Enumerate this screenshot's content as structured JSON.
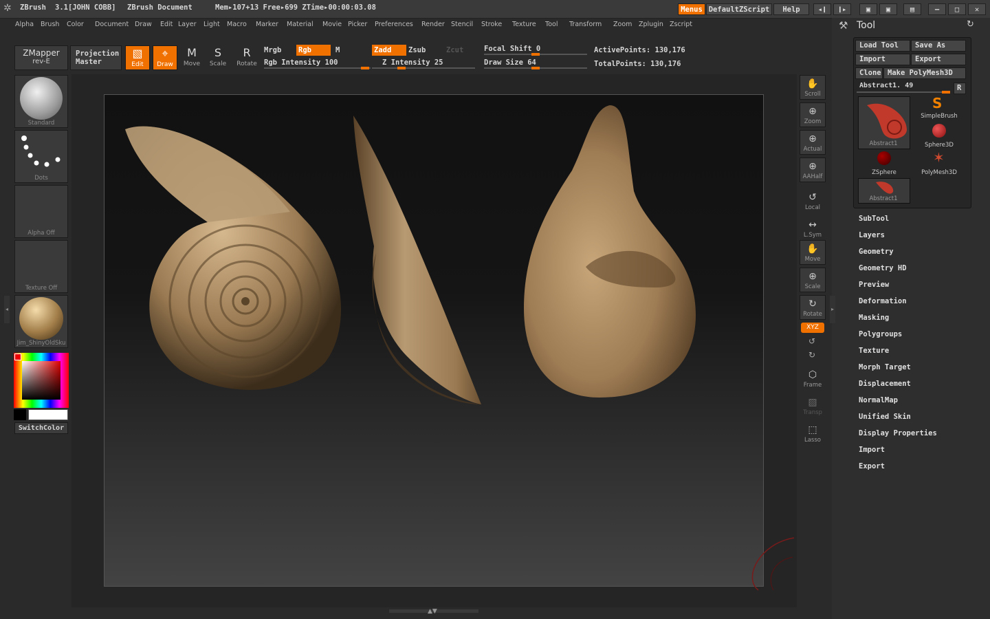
{
  "title_bar": {
    "app": "ZBrush",
    "version": "3.1[JOHN COBB]",
    "document": "ZBrush Document",
    "mem": "Mem▸107+13  Free▸699  ZTime▸00:00:03.08",
    "menus_label": "Menus",
    "script_label": "DefaultZScript",
    "help_label": "Help"
  },
  "menu_bar": [
    "Alpha",
    "Brush",
    "Color",
    "Document",
    "Draw",
    "Edit",
    "Layer",
    "Light",
    "Macro",
    "Marker",
    "Material",
    "Movie",
    "Picker",
    "Preferences",
    "Render",
    "Stencil",
    "Stroke",
    "Texture",
    "Tool",
    "Transform",
    "Zoom",
    "Zplugin",
    "Zscript"
  ],
  "toolbar": {
    "zmapper_label": "ZMapper",
    "zmapper_sub": "rev-E",
    "projection_label": "Projection",
    "projection_sub": "Master",
    "edit_label": "Edit",
    "draw_label": "Draw",
    "move_label": "Move",
    "scale_label": "Scale",
    "rotate_label": "Rotate",
    "mrgb_label": "Mrgb",
    "rgb_label": "Rgb",
    "m_label": "M",
    "rgb_intensity": "Rgb Intensity 100",
    "zadd_label": "Zadd",
    "zsub_label": "Zsub",
    "zcut_label": "Zcut",
    "z_intensity": "Z Intensity 25",
    "focal_shift": "Focal Shift 0",
    "draw_size": "Draw Size 64",
    "active_points": "ActivePoints: 130,176",
    "total_points": "TotalPoints: 130,176"
  },
  "left_shelf": {
    "brush_label": "Standard",
    "stroke_label": "Dots",
    "alpha_label": "Alpha  Off",
    "texture_label": "Texture  Off",
    "material_label": "Jim_ShinyOldSku",
    "switch_color_label": "SwitchColor"
  },
  "right_shelf": [
    "Scroll",
    "Zoom",
    "Actual",
    "AAHalf",
    "Local",
    "L.Sym",
    "Move",
    "Scale",
    "Rotate",
    "XYZ",
    "Frame",
    "Transp",
    "Lasso"
  ],
  "tool_panel": {
    "title": "Tool",
    "load_tool": "Load Tool",
    "save_as": "Save As",
    "import": "Import",
    "export": "Export",
    "clone": "Clone",
    "make_polymesh": "Make PolyMesh3D",
    "current_tool": "Abstract1. 49",
    "r_label": "R",
    "thumbnails": [
      "Abstract1",
      "SimpleBrush",
      "Sphere3D",
      "ZSphere",
      "PolyMesh3D",
      "Abstract1"
    ],
    "subpalettes": [
      "SubTool",
      "Layers",
      "Geometry",
      "Geometry HD",
      "Preview",
      "Deformation",
      "Masking",
      "Polygroups",
      "Texture",
      "Morph Target",
      "Displacement",
      "NormalMap",
      "Unified Skin",
      "Display Properties",
      "Import",
      "Export"
    ]
  },
  "colors": {
    "accent": "#f07000",
    "model": "#a08060",
    "background": "#2a2a2a"
  }
}
